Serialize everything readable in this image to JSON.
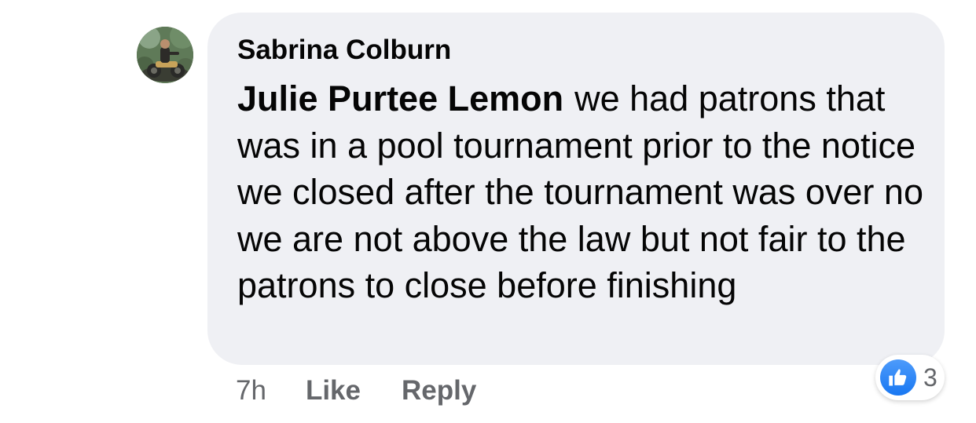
{
  "comment": {
    "author": "Sabrina Colburn",
    "mention": "Julie Purtee Lemon",
    "text": "we had patrons that was in a pool tournament prior to the notice we closed after the tournament was over no we are not above the law but not fair to the patrons to close before finishing",
    "timestamp": "7h",
    "like_label": "Like",
    "reply_label": "Reply",
    "reaction_count": "3",
    "reaction_icon": "thumbs-up-icon"
  },
  "colors": {
    "bubble_background": "#eff0f4",
    "text": "#050505",
    "secondary_text": "#65676b",
    "like_blue": "#1877f2"
  }
}
